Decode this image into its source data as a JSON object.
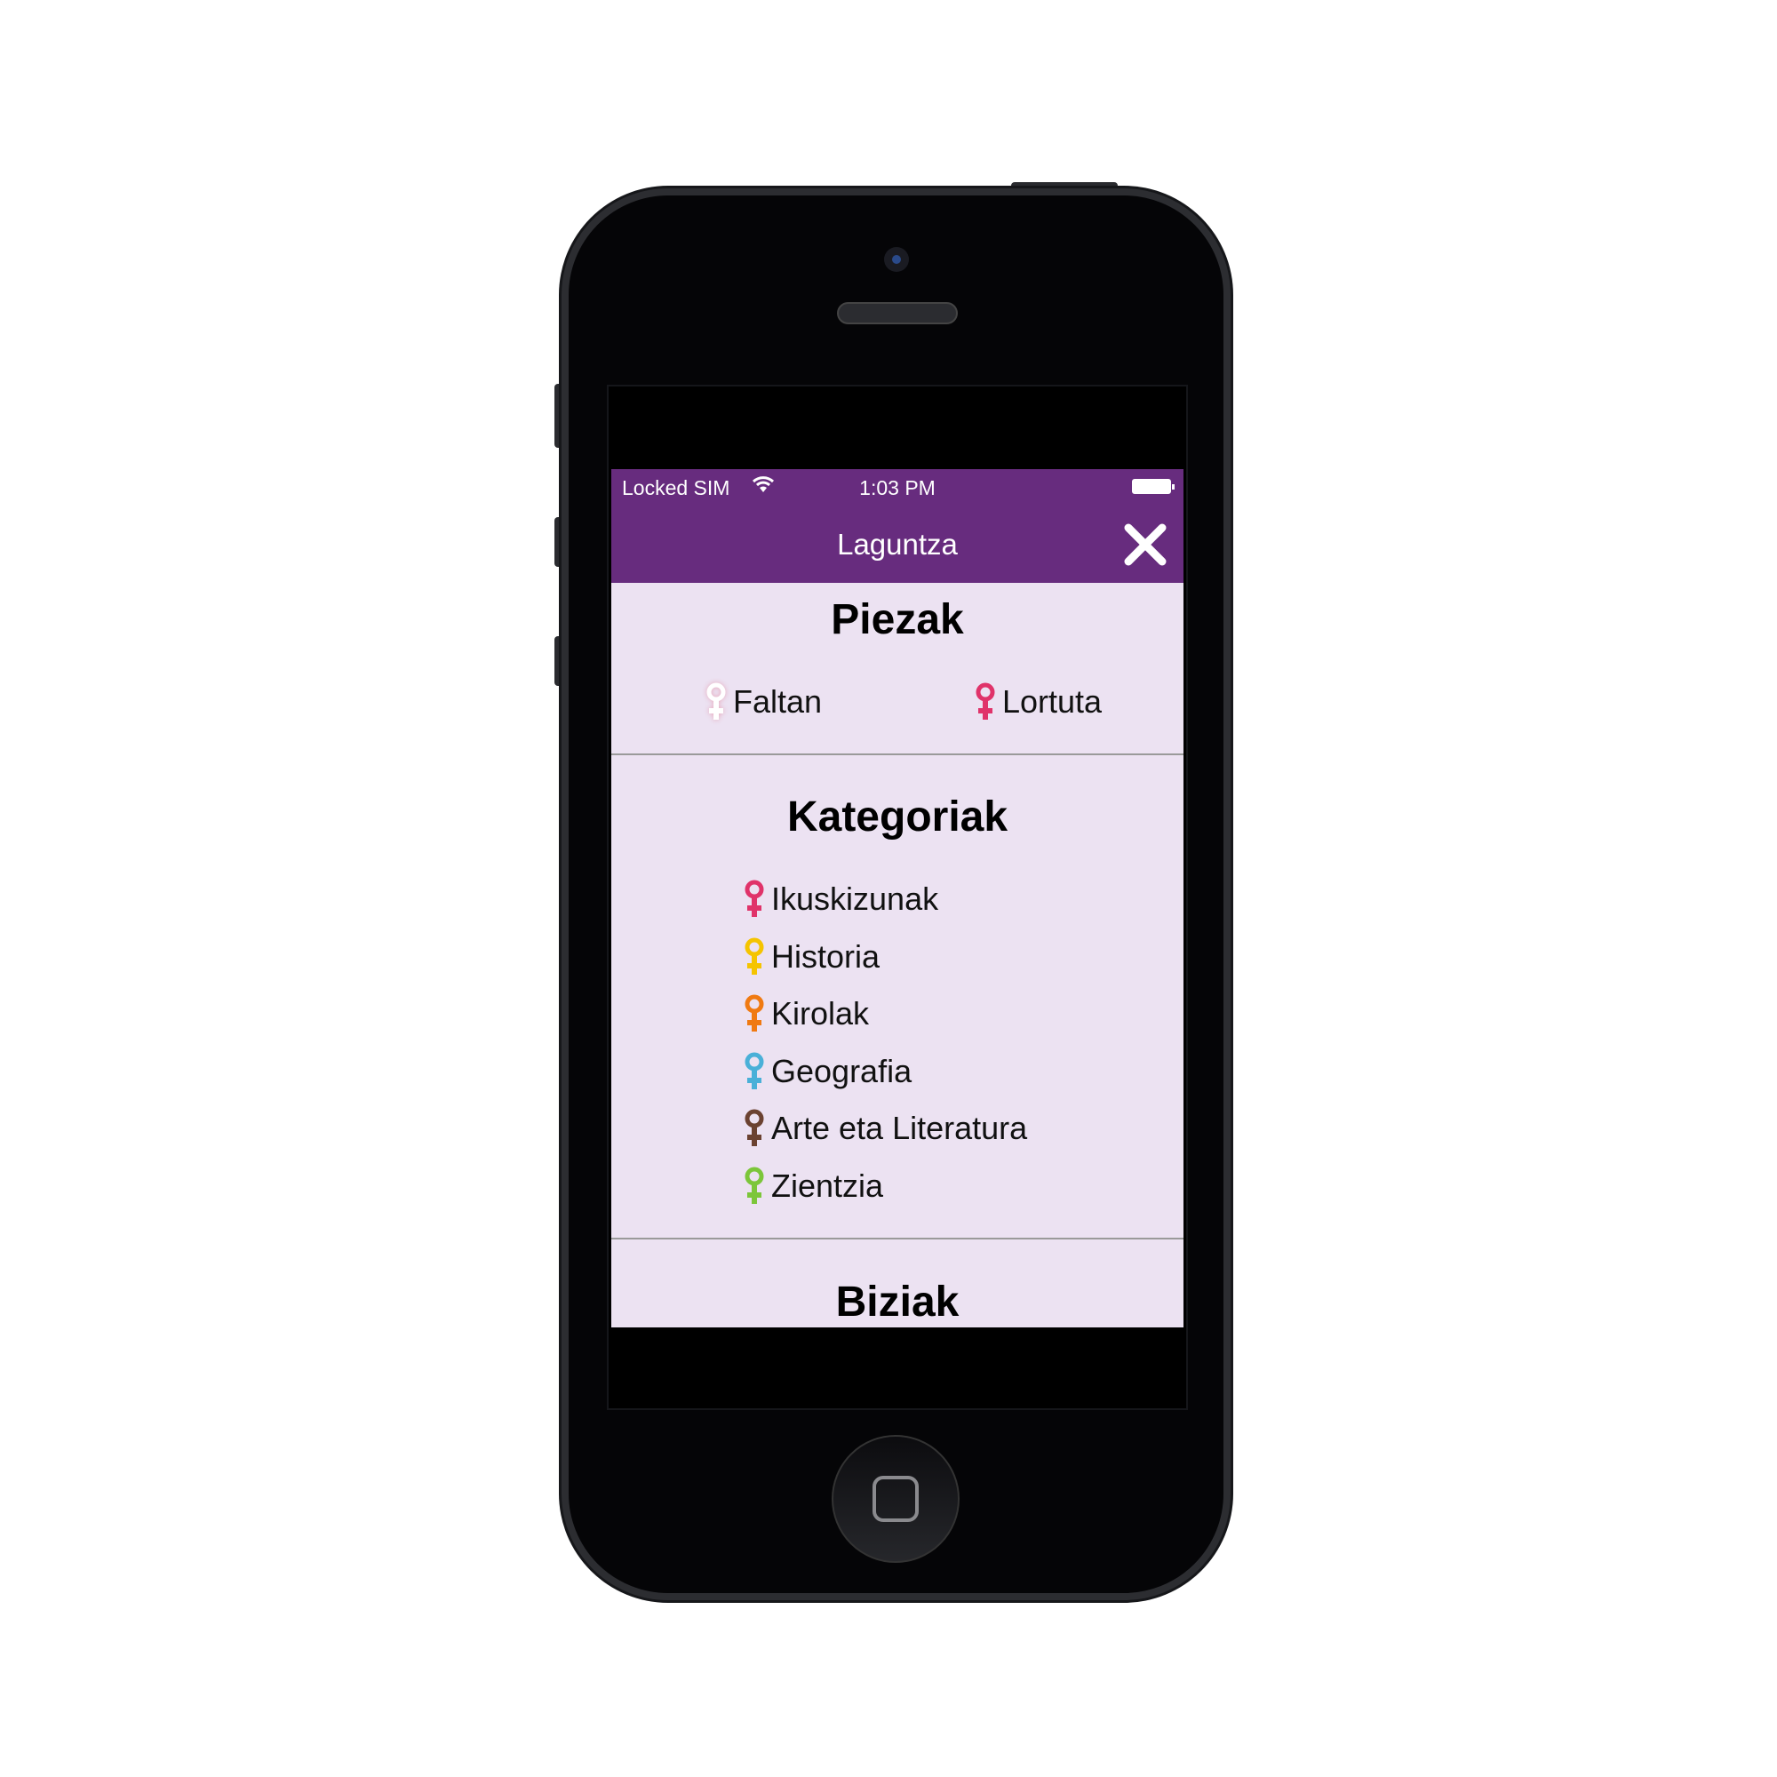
{
  "status_bar": {
    "carrier": "Locked SIM",
    "time": "1:03 PM",
    "wifi_icon": "wifi-icon",
    "battery_icon": "battery-icon"
  },
  "nav": {
    "title": "Laguntza",
    "close_icon": "close-icon"
  },
  "pieces": {
    "title": "Piezak",
    "legend": [
      {
        "label": "Faltan",
        "color": "#ffffff"
      },
      {
        "label": "Lortuta",
        "color": "#e0336a"
      }
    ]
  },
  "categories": {
    "title": "Kategoriak",
    "items": [
      {
        "label": "Ikuskizunak",
        "color": "#e0336a"
      },
      {
        "label": "Historia",
        "color": "#f5c400"
      },
      {
        "label": "Kirolak",
        "color": "#f07a12"
      },
      {
        "label": "Geografia",
        "color": "#4ab0d8"
      },
      {
        "label": "Arte eta Literatura",
        "color": "#6b4231"
      },
      {
        "label": "Zientzia",
        "color": "#7cc63a"
      }
    ]
  },
  "lives": {
    "title": "Biziak"
  },
  "colors": {
    "accent": "#672c7e",
    "background": "#ece2f2"
  }
}
